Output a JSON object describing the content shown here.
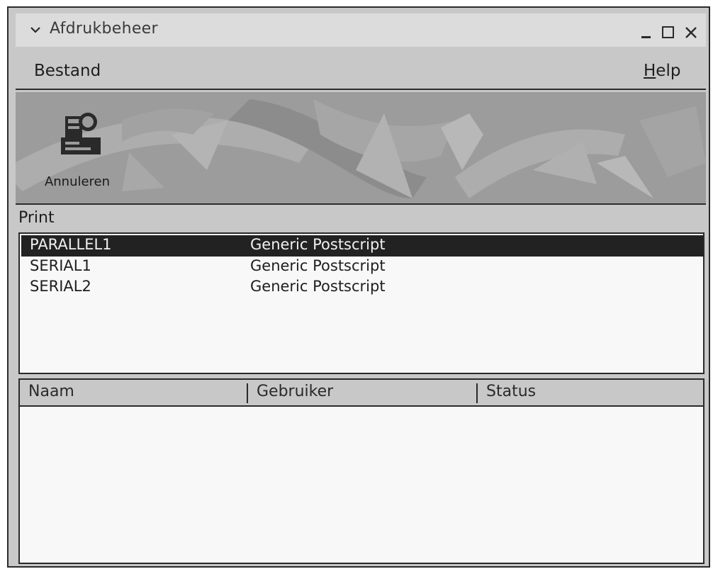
{
  "window": {
    "title": "Afdrukbeheer"
  },
  "menubar": {
    "file": "Bestand",
    "help_prefix": "",
    "help_accel": "H",
    "help_rest": "elp"
  },
  "toolbar": {
    "cancel_label": "Annuleren"
  },
  "printers": {
    "section_label": "Print",
    "rows": [
      {
        "name": "PARALLEL1",
        "driver": "Generic Postscript",
        "selected": true
      },
      {
        "name": "SERIAL1",
        "driver": "Generic Postscript",
        "selected": false
      },
      {
        "name": "SERIAL2",
        "driver": "Generic Postscript",
        "selected": false
      }
    ]
  },
  "jobs": {
    "columns": [
      "Naam",
      "Gebruiker",
      "Status"
    ],
    "rows": []
  },
  "colors": {
    "selection": "#222222",
    "window_bg": "#c8c8c8",
    "list_bg": "#f8f8f8"
  }
}
